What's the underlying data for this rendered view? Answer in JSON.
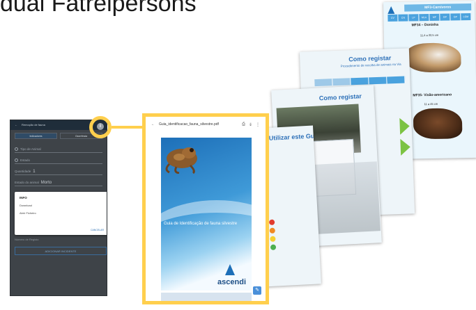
{
  "heading": "dual Fatrelpersons",
  "phone": {
    "appbar_back": "←",
    "appbar_title": "Remoção de fauna",
    "tabs": [
      "Indicadores",
      "Ocorrência"
    ],
    "fields": [
      {
        "label": "Tipo de Animal"
      },
      {
        "label": "Estado"
      },
      {
        "label": "Quantidade",
        "value": "1"
      },
      {
        "label": "Estado do animal",
        "value": "Morto"
      }
    ],
    "dialog": {
      "title": "INFO",
      "items": [
        "Download",
        "Abrir Ficheiro"
      ],
      "cancel": "CANCELAR"
    },
    "below_label": "Número de Registo",
    "add_button": "ADICIONAR INCIDENTE",
    "info_icon": "i"
  },
  "viewer": {
    "back_arrow": "←",
    "filename": "Guia_identificacao_fauna_silvestre.pdf",
    "tools": [
      "⎙",
      "⇓",
      "⋮"
    ],
    "cover_title": "Guia de Identificação de fauna silvestre",
    "brand": "ascendi",
    "fab": "✎"
  },
  "pages": {
    "p1": {
      "title": "Como Utilizar este Guia"
    },
    "p2": {
      "title": "Como registar"
    },
    "p3": {
      "title": "Como registar",
      "subtitle": "Procedimento de recolha de animais na Via"
    },
    "p4": {
      "header": "MF3-Carnívoros",
      "strip": [
        "CV",
        "CN",
        "LP",
        "MLA",
        "MF",
        "GP",
        "GP",
        "LGM"
      ],
      "species_a": "MF34 – Doninha",
      "size_a": "11,4 a 22,5 cm",
      "species_b": "MF35- Visão-americano",
      "size_b": "11 a 45 cm"
    }
  },
  "colors": {
    "highlight": "#ffcf4d",
    "brand_blue": "#2d70b8"
  }
}
